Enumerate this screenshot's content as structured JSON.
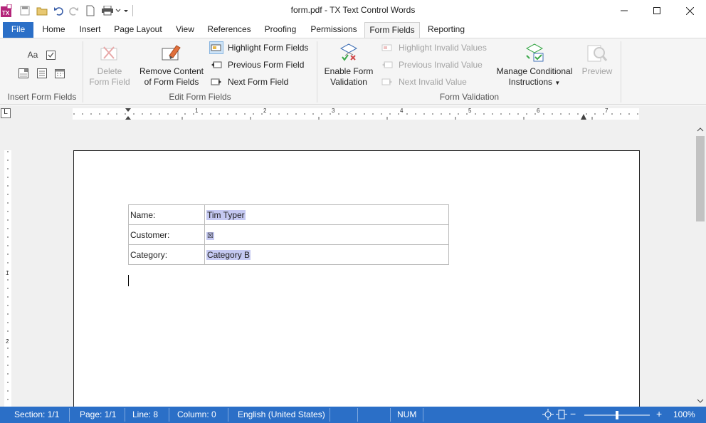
{
  "app": {
    "window_title": "form.pdf - TX Text Control Words"
  },
  "tabs": [
    "File",
    "Home",
    "Insert",
    "Page Layout",
    "View",
    "References",
    "Proofing",
    "Permissions",
    "Form Fields",
    "Reporting"
  ],
  "active_tab": "Form Fields",
  "ribbon": {
    "insert_group": {
      "label": "Insert Form Fields",
      "text_field_label": "Aa"
    },
    "edit_group": {
      "label": "Edit Form Fields",
      "delete_line1": "Delete",
      "delete_line2": "Form Field",
      "remove_line1": "Remove Content",
      "remove_line2": "of Form Fields",
      "highlight": "Highlight Form Fields",
      "previous": "Previous Form Field",
      "next": "Next Form Field"
    },
    "validation_group": {
      "label": "Form Validation",
      "enable_line1": "Enable Form",
      "enable_line2": "Validation",
      "highlight_invalid": "Highlight Invalid Values",
      "previous_invalid": "Previous Invalid Value",
      "next_invalid": "Next Invalid Value",
      "manage_line1": "Manage Conditional",
      "manage_line2": "Instructions",
      "preview": "Preview"
    }
  },
  "ruler": {
    "corner": "L",
    "numbers": [
      "1",
      "2",
      "3",
      "4",
      "5",
      "6",
      "7"
    ],
    "vertical_numbers": [
      "1",
      "2"
    ]
  },
  "document": {
    "rows": [
      {
        "label": "Name:",
        "value": "Tim Typer"
      },
      {
        "label": "Customer:",
        "value": "☒"
      },
      {
        "label": "Category:",
        "value": "Category B"
      }
    ]
  },
  "status": {
    "section": "Section: 1/1",
    "page": "Page: 1/1",
    "line": "Line: 8",
    "column": "Column: 0",
    "language": "English (United States)",
    "num": "NUM",
    "zoom": "100%",
    "zoom_minus": "−",
    "zoom_plus": "+",
    "zoom_level": 0.5
  },
  "colors": {
    "accent": "#2b6fc7",
    "form_field_highlight": "#c5c9f2"
  }
}
